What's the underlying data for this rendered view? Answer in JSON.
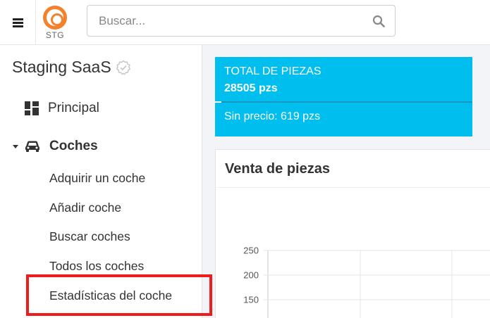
{
  "topbar": {
    "menu_icon": "hamburger-icon",
    "logo_text": "STG",
    "search": {
      "placeholder": "Buscar...",
      "value": "",
      "icon": "search-icon"
    }
  },
  "sidebar": {
    "tenant_name": "Staging SaaS",
    "tenant_icon": "verified-check-icon",
    "principal": {
      "label": "Principal",
      "icon": "dashboard-icon"
    },
    "coches": {
      "label": "Coches",
      "icon": "car-icon",
      "expanded": true,
      "items": [
        {
          "label": "Adquirir un coche"
        },
        {
          "label": "Añadir coche"
        },
        {
          "label": "Buscar coches"
        },
        {
          "label": "Todos los coches"
        },
        {
          "label": "Estadísticas del coche",
          "highlighted": true
        }
      ]
    }
  },
  "stat_card": {
    "title": "TOTAL DE PIEZAS",
    "total": "28505 pzs",
    "no_price": "Sin precio: 619 pzs",
    "color": "#00bfef"
  },
  "chart_panel": {
    "title": "Venta de piezas"
  },
  "chart_data": {
    "type": "line",
    "title": "Venta de piezas",
    "xlabel": "",
    "ylabel": "",
    "y_ticks": [
      250,
      200,
      150
    ],
    "ylim_visible": [
      150,
      250
    ],
    "grid": true,
    "series": []
  },
  "colors": {
    "accent": "#00bfef",
    "logo": "#f4812c",
    "highlight": "#ee1c1c"
  }
}
